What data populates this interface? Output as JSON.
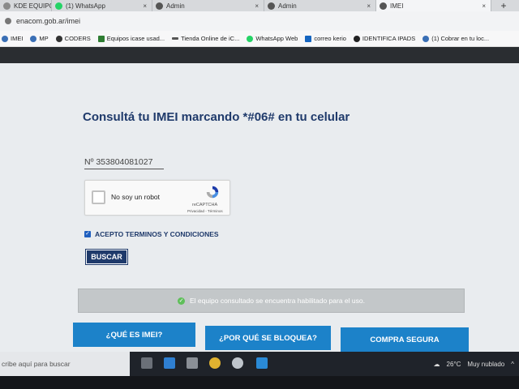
{
  "browser": {
    "tabs": [
      {
        "label": "KDE EQUIPO",
        "favicon_color": "#8a8a8a"
      },
      {
        "label": "(1) WhatsApp",
        "favicon_color": "#25d366"
      },
      {
        "label": "Admin",
        "favicon_color": "#555555"
      },
      {
        "label": "Admin",
        "favicon_color": "#555555"
      },
      {
        "label": "IMEI",
        "favicon_color": "#555555"
      }
    ],
    "close_glyph": "×",
    "new_tab_glyph": "+",
    "url": "enacom.gob.ar/imei",
    "bookmarks": [
      {
        "label": "IMEI",
        "icon": "globe-icon",
        "color": "#3a6fb5"
      },
      {
        "label": "MP",
        "icon": "globe-icon",
        "color": "#3a6fb5"
      },
      {
        "label": "CODERS",
        "icon": "globe-icon",
        "color": "#333333"
      },
      {
        "label": "Equipos icase usad...",
        "icon": "bookmark-icon",
        "color": "#2e7d32"
      },
      {
        "label": "Tienda Online de iC...",
        "icon": "bookmark-icon",
        "color": "#555555"
      },
      {
        "label": "WhatsApp Web",
        "icon": "whatsapp-icon",
        "color": "#25d366"
      },
      {
        "label": "correo kerio",
        "icon": "mail-icon",
        "color": "#1565c0"
      },
      {
        "label": "IDENTIFICA IPADS",
        "icon": "apple-icon",
        "color": "#222222"
      },
      {
        "label": "(1) Cobrar en tu loc...",
        "icon": "globe-icon",
        "color": "#3a6fb5"
      }
    ]
  },
  "page": {
    "title": "Consultá tu IMEI marcando *#06# en tu celular",
    "imei_value": "Nº 353804081027",
    "recaptcha": {
      "label": "No soy un robot",
      "brand": "reCAPTCHA",
      "terms": "Privacidad - Términos"
    },
    "terms_label": "ACEPTO TERMINOS Y CONDICIONES",
    "terms_checked_glyph": "✓",
    "search_button": "BUSCAR",
    "status_message": "El equipo consultado se encuentra habilitado para el uso.",
    "status_glyph": "✓",
    "nav_buttons": [
      "¿QUÉ ES IMEI?",
      "¿POR QUÉ SE BLOQUEA?",
      "COMPRA SEGURA"
    ],
    "colors": {
      "primary": "#1f3a6b",
      "accent": "#1c82c9",
      "success": "#5fbf5a"
    }
  },
  "taskbar": {
    "search_text": "cribe aquí para buscar",
    "weather": "26°C",
    "weather_desc": "Muy nublado"
  }
}
